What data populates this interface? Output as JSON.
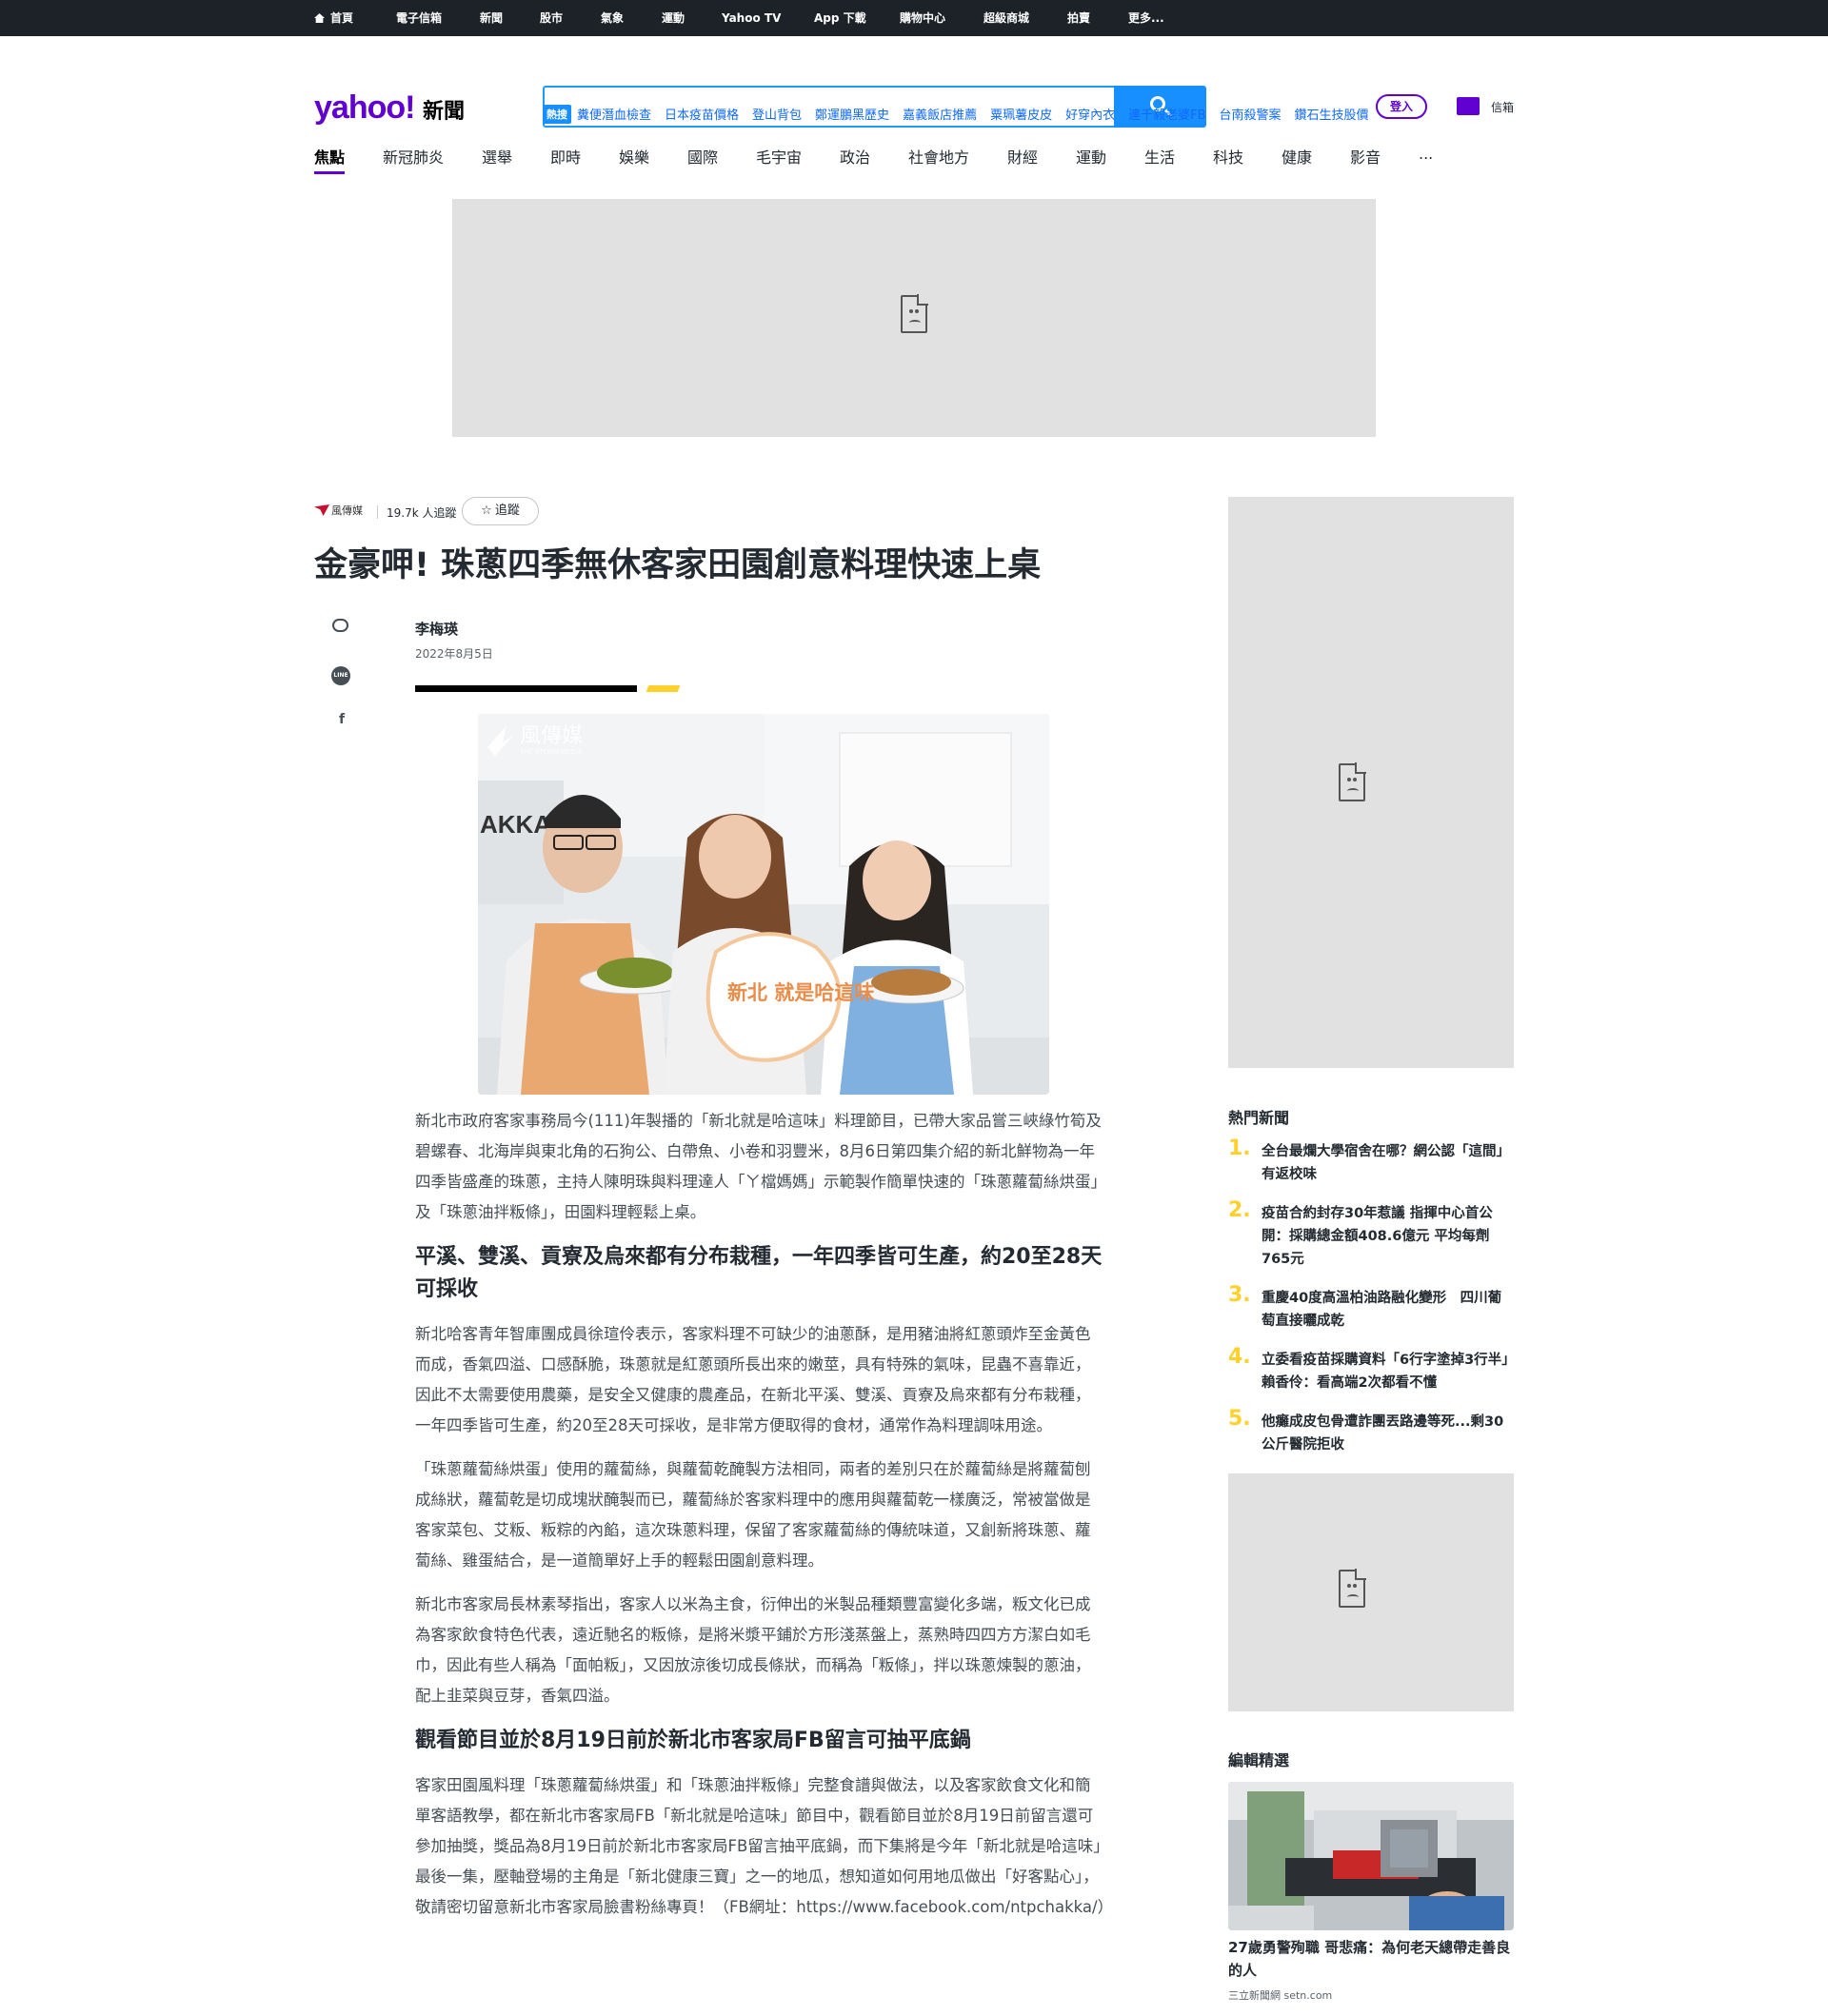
{
  "topbar": {
    "items": [
      "首頁",
      "電子信箱",
      "新聞",
      "股市",
      "氣象",
      "運動",
      "Yahoo TV",
      "App 下載",
      "購物中心",
      "超級商城",
      "拍賣",
      "更多..."
    ],
    "active": "新聞"
  },
  "header": {
    "logo": "yahoo!",
    "logo_sub": "新聞",
    "search_placeholder": "",
    "signin_label": "登入",
    "mail_label": "信箱"
  },
  "trending": {
    "badge": "熱搜",
    "links": [
      "糞便潛血檢查",
      "日本疫苗價格",
      "登山背包",
      "鄭運鵬黑歷史",
      "嘉義飯店推薦",
      "粟珮薯皮皮",
      "好穿內衣",
      "連千毅老婆FB",
      "台南殺警案",
      "鑽石生技股價"
    ]
  },
  "nav": {
    "tabs": [
      "焦點",
      "新冠肺炎",
      "選舉",
      "即時",
      "娛樂",
      "國際",
      "毛宇宙",
      "政治",
      "社會地方",
      "財經",
      "運動",
      "生活",
      "科技",
      "健康",
      "影音",
      "..."
    ],
    "active": "焦點"
  },
  "article": {
    "provider": "風傳媒",
    "followers": "19.7k 人追蹤",
    "follow_label": "追蹤",
    "title": "金豪呷! 珠蔥四季無休客家田園創意料理快速上桌",
    "author": "李梅瑛",
    "date": "2022年8月5日",
    "photo_watermark": "風傳媒",
    "photo_watermark_sub": "THE STORM MEDIA",
    "photo_sign": "新北 就是哈這味",
    "photo_bg_text": "AKKA",
    "paragraphs": [
      "新北市政府客家事務局今(111)年製播的「新北就是哈這味」料理節目，已帶大家品嘗三峽綠竹筍及碧螺春、北海岸與東北角的石狗公、白帶魚、小卷和羽豐米，8月6日第四集介紹的新北鮮物為一年四季皆盛產的珠蔥，主持人陳明珠與料理達人「ㄚ檔媽媽」示範製作簡單快速的「珠蔥蘿蔔絲烘蛋」及「珠蔥油拌粄條」，田園料理輕鬆上桌。"
    ],
    "heading1": "平溪、雙溪、貢寮及烏來都有分布栽種，一年四季皆可生產，約20至28天可採收",
    "paragraphs2": [
      "新北哈客青年智庫團成員徐瑄伶表示，客家料理不可缺少的油蔥酥，是用豬油將紅蔥頭炸至金黃色而成，香氣四溢、口感酥脆，珠蔥就是紅蔥頭所長出來的嫩莖，具有特殊的氣味，昆蟲不喜靠近，因此不太需要使用農藥，是安全又健康的農產品，在新北平溪、雙溪、貢寮及烏來都有分布栽種，一年四季皆可生產，約20至28天可採收，是非常方便取得的食材，通常作為料理調味用途。",
      "「珠蔥蘿蔔絲烘蛋」使用的蘿蔔絲，與蘿蔔乾醃製方法相同，兩者的差別只在於蘿蔔絲是將蘿蔔刨成絲狀，蘿蔔乾是切成塊狀醃製而已，蘿蔔絲於客家料理中的應用與蘿蔔乾一樣廣泛，常被當做是客家菜包、艾粄、粄粽的內餡，這次珠蔥料理，保留了客家蘿蔔絲的傳統味道，又創新將珠蔥、蘿蔔絲、雞蛋結合，是一道簡單好上手的輕鬆田園創意料理。",
      "新北市客家局長林素琴指出，客家人以米為主食，衍伸出的米製品種類豐富變化多端，粄文化已成為客家飲食特色代表，遠近馳名的粄條，是將米漿平鋪於方形淺蒸盤上，蒸熟時四四方方潔白如毛巾，因此有些人稱為「面帕粄」，又因放涼後切成長條狀，而稱為「粄條」，拌以珠蔥煉製的蔥油，配上韭菜與豆芽，香氣四溢。"
    ],
    "heading2": "觀看節目並於8月19日前於新北市客家局FB留言可抽平底鍋",
    "paragraphs3": [
      "客家田園風料理「珠蔥蘿蔔絲烘蛋」和「珠蔥油拌粄條」完整食譜與做法，以及客家飲食文化和簡單客語教學，都在新北市客家局FB「新北就是哈這味」節目中，觀看節目並於8月19日前留言還可參加抽獎，獎品為8月19日前於新北市客家局FB留言抽平底鍋，而下集將是今年「新北就是哈這味」最後一集，壓軸登場的主角是「新北健康三寶」之一的地瓜，想知道如何用地瓜做出「好客點心」，敬請密切留意新北市客家局臉書粉絲專頁！（FB網址：https://www.facebook.com/ntpchakka/）"
    ]
  },
  "sidebar": {
    "hot_heading": "熱門新聞",
    "hot_items": [
      {
        "num": "1.",
        "text": "全台最爛大學宿舍在哪？網公認「這間」有返校味"
      },
      {
        "num": "2.",
        "text": "疫苗合約封存30年惹議 指揮中心首公開：採購總金額408.6億元 平均每劑765元"
      },
      {
        "num": "3.",
        "text": "重慶40度高溫柏油路融化變形　四川葡萄直接曬成乾"
      },
      {
        "num": "4.",
        "text": "立委看疫苗採購資料「6行字塗掉3行半」　賴香伶：看高端2次都看不懂"
      },
      {
        "num": "5.",
        "text": "他癱成皮包骨遭詐團丟路邊等死...剩30公斤醫院拒收"
      }
    ],
    "picks_heading": "編輯精選",
    "pick_title": "27歲勇警殉職 哥悲痛：為何老天總帶走善良的人",
    "pick_source": "三立新聞網 setn.com"
  },
  "colors": {
    "brand": "#6001d2",
    "search_blue": "#188fff",
    "accent_yellow": "#ffd12a",
    "topbar": "#1d2228"
  }
}
